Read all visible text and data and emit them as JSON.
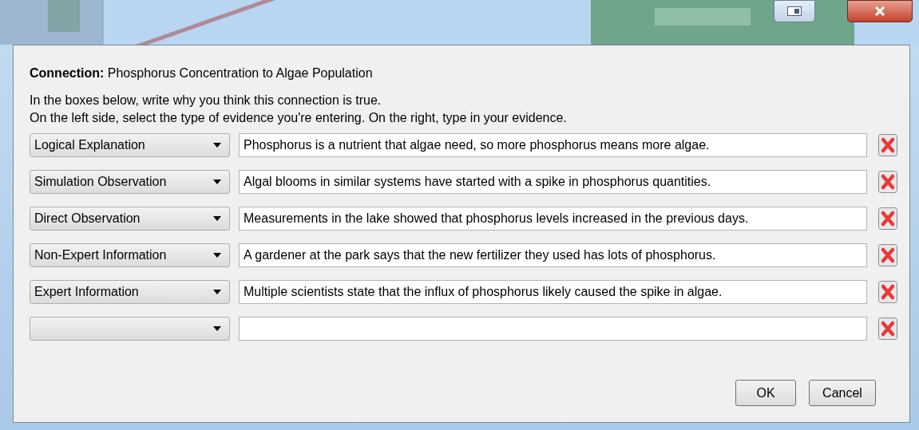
{
  "connection": "**Connection:** Phosphorus Concentration to Algae Population",
  "instructions": [
    "In the boxes below, write why you think this connection is true.",
    "On the left side, select the type of evidence you're entering. On the right, type in your evidence."
  ],
  "rows": [
    {
      "evidence_type": "Logical Explanation",
      "evidence": "Phosphorus is a nutrient that algae need, so more phosphorus means more algae."
    },
    {
      "evidence_type": "Simulation Observation",
      "evidence": "Algal blooms in similar systems have started with a spike in phosphorus quantities."
    },
    {
      "evidence_type": "Direct Observation",
      "evidence": "Measurements in the lake showed that phosphorus levels increased in the previous days."
    },
    {
      "evidence_type": "Non-Expert Information",
      "evidence": "A gardener at the park says that the new fertilizer they used has lots of phosphorus."
    },
    {
      "evidence_type": "Expert Information",
      "evidence": "Multiple scientists state that the influx of phosphorus likely caused the spike in algae."
    },
    {}
  ],
  "buttons": [
    "OK",
    "Cancel"
  ]
}
